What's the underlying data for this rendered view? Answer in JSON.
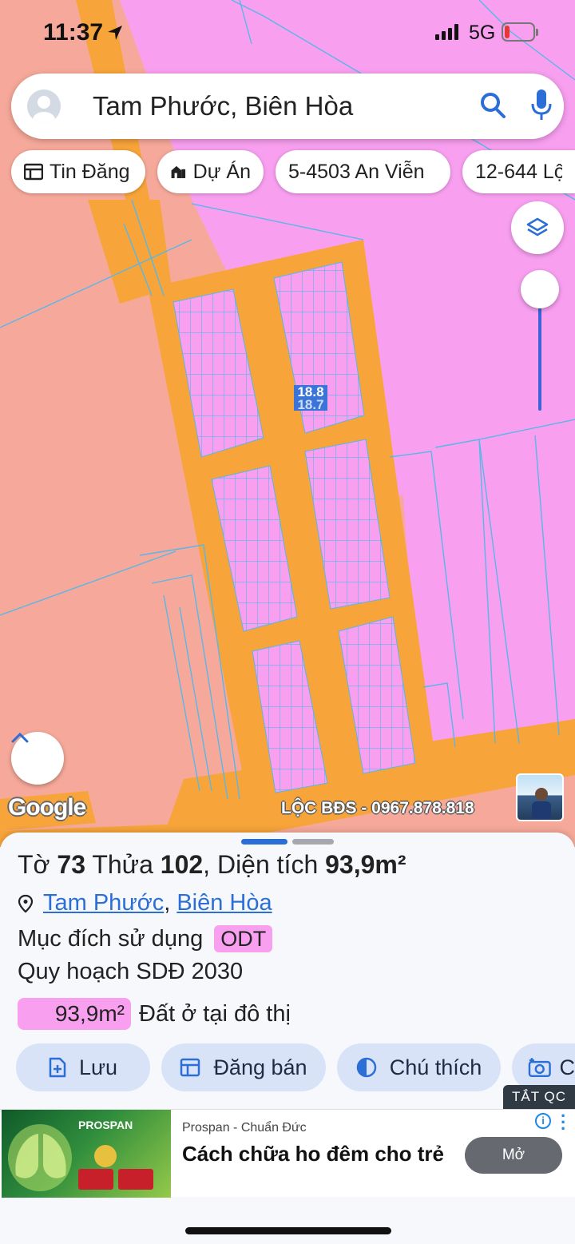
{
  "status_bar": {
    "time": "11:37",
    "network": "5G"
  },
  "search": {
    "query": "Tam Phước, Biên Hòa"
  },
  "chips": [
    {
      "label": "Tin Đăng",
      "icon": "listing-icon"
    },
    {
      "label": "Dự Án",
      "icon": "building-icon"
    },
    {
      "label": "5-4503 An Viễn",
      "icon": ""
    },
    {
      "label": "12-644 Lộ",
      "icon": ""
    }
  ],
  "map": {
    "plot_label_top": "18.8",
    "plot_label_bottom": "18.7",
    "google_logo": "Google",
    "watermark": "LỘC BĐS - 0967.878.818",
    "colors": {
      "residential": "#f89ff0",
      "road": "#f7a43a",
      "agricultural": "#f6a99a",
      "boundary": "#58b7e8"
    }
  },
  "details": {
    "title_sheet_prefix": "Tờ",
    "sheet_no": "73",
    "title_parcel_prefix": "Thửa",
    "parcel_no": "102",
    "title_area_prefix": ", Diện tích",
    "area": "93,9m²",
    "location_commune": "Tam Phước",
    "location_sep": ",",
    "location_city": "Biên Hòa",
    "purpose_label": "Mục đích sử dụng",
    "purpose_code": "ODT",
    "plan_label": "Quy hoạch SDĐ 2030",
    "plan_area": "93,9m²",
    "plan_desc": "Đất ở tại đô thị"
  },
  "actions": [
    {
      "label": "Lưu",
      "icon": "add-file-icon"
    },
    {
      "label": "Đăng bán",
      "icon": "listing-icon"
    },
    {
      "label": "Chú thích",
      "icon": "contrast-icon"
    },
    {
      "label": "C",
      "icon": "camera-icon"
    }
  ],
  "ad": {
    "close_label": "TẮT QC",
    "brand_text": "PROSPAN",
    "sponsor": "Prospan - Chuẩn Đức",
    "headline": "Cách chữa ho đêm cho trẻ",
    "cta": "Mở"
  }
}
